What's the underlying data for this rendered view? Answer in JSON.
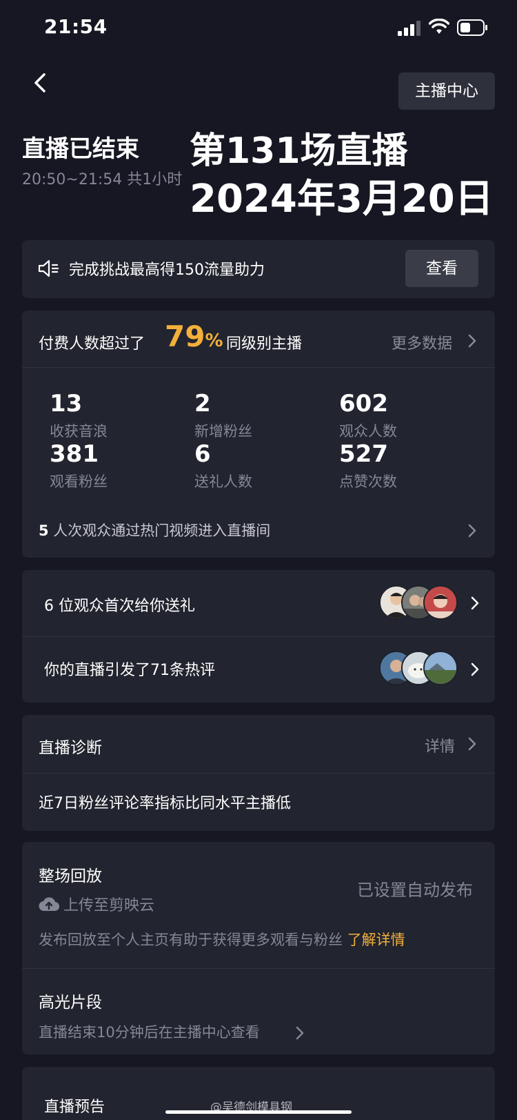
{
  "status_bar": {
    "time": "21:54"
  },
  "header": {
    "back_icon": "chevron-left-icon",
    "host_center_label": "主播中心",
    "title": "直播已结束",
    "time_range": "20:50~21:54 共1小时",
    "overlay_session": "第131场直播",
    "overlay_date": "2024年3月20日"
  },
  "challenge": {
    "text": "完成挑战最高得150流量助力",
    "button_label": "查看",
    "icon": "speaker-icon"
  },
  "pay_stats": {
    "prefix": "付费人数超过了",
    "percent": "79",
    "percent_sign": "%",
    "suffix": "同级别主播",
    "more_data_label": "更多数据",
    "stats": [
      {
        "value": "13",
        "label": "收获音浪"
      },
      {
        "value": "2",
        "label": "新增粉丝"
      },
      {
        "value": "602",
        "label": "观众人数"
      },
      {
        "value": "381",
        "label": "观看粉丝"
      },
      {
        "value": "6",
        "label": "送礼人数"
      },
      {
        "value": "527",
        "label": "点赞次数"
      }
    ],
    "hot_video_count": "5",
    "hot_video_text": " 人次观众通过热门视频进入直播间"
  },
  "audience": {
    "first_gift_text": "6 位观众首次给你送礼",
    "hot_comment_text": "你的直播引发了71条热评"
  },
  "diagnosis": {
    "title": "直播诊断",
    "details_label": "详情",
    "text": "近7日粉丝评论率指标比同水平主播低"
  },
  "replay": {
    "title": "整场回放",
    "upload_text": "上传至剪映云",
    "auto_publish_label": "已设置自动发布",
    "publish_hint": "发布回放至个人主页有助于获得更多观看与粉丝",
    "learn_more_label": "了解详情",
    "highlight_title": "高光片段",
    "highlight_hint": "直播结束10分钟后在主播中心查看"
  },
  "preview": {
    "title": "直播预告"
  },
  "watermark": "@吴德剑模具钢",
  "colors": {
    "background": "#161722",
    "card": "#22242f",
    "accent": "#f3b03a",
    "muted": "#858796"
  }
}
